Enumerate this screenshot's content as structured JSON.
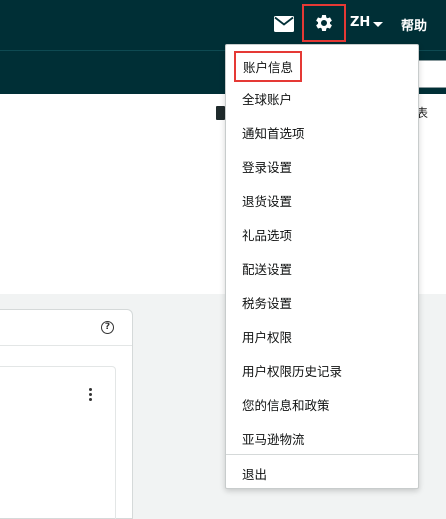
{
  "header": {
    "mail_icon": "mail-icon",
    "settings_icon": "gear-icon",
    "language": "ZH",
    "help": "帮助",
    "highlight_color": "#e53935",
    "background_color": "#002f36"
  },
  "page": {
    "peek_text": "表"
  },
  "card": {
    "help_icon_glyph": "?",
    "menu_icon": "kebab-menu-icon"
  },
  "settings_menu": {
    "items": [
      {
        "label": "账户信息",
        "highlighted": true
      },
      {
        "label": "全球账户"
      },
      {
        "label": "通知首选项"
      },
      {
        "label": "登录设置"
      },
      {
        "label": "退货设置"
      },
      {
        "label": "礼品选项"
      },
      {
        "label": "配送设置"
      },
      {
        "label": "税务设置"
      },
      {
        "label": "用户权限"
      },
      {
        "label": "用户权限历史记录"
      },
      {
        "label": "您的信息和政策"
      },
      {
        "label": "亚马逊物流"
      }
    ],
    "logout": "退出"
  }
}
